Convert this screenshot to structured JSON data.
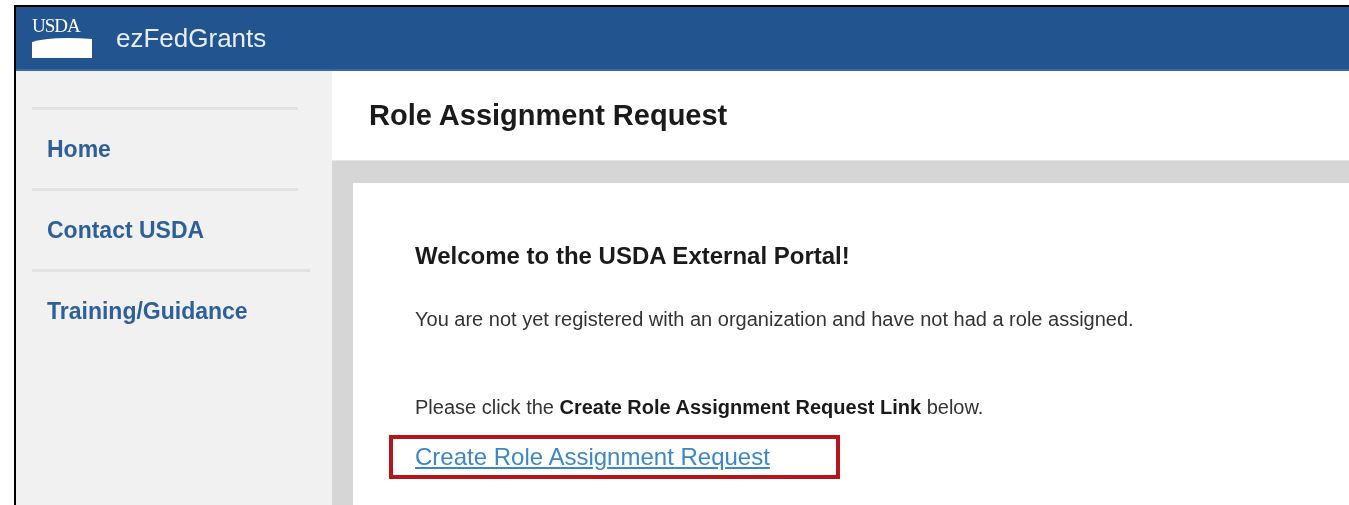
{
  "header": {
    "logo": "USDA",
    "app_name": "ezFedGrants"
  },
  "sidebar": {
    "items": [
      {
        "label": "Home"
      },
      {
        "label": "Contact USDA"
      },
      {
        "label": "Training/Guidance"
      }
    ]
  },
  "page_title": "Role Assignment Request",
  "card": {
    "heading": "Welcome to the USDA External Portal!",
    "message": "You are not yet registered with an organization and have not had a role assigned.",
    "instruction": "Please click the **Create Role Assignment Request Link** below.",
    "link": {
      "label": "Create Role Assignment Request",
      "highlighted": true
    }
  }
}
